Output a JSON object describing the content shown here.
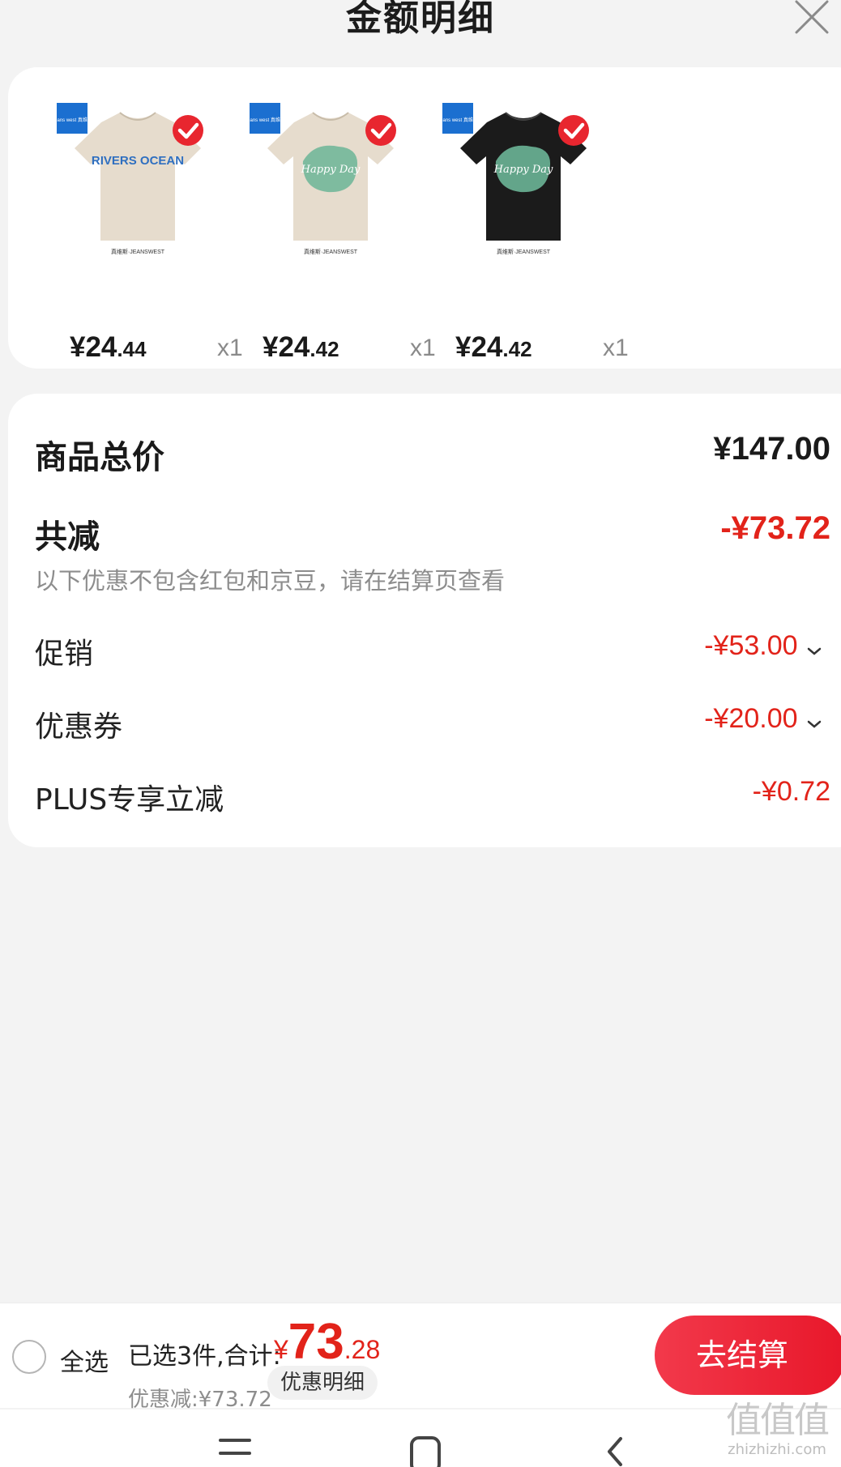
{
  "header": {
    "title": "金额明细",
    "close_icon": "close-icon"
  },
  "products": [
    {
      "price_int": "¥24",
      "price_dec": ".44",
      "qty": "x1",
      "shirt_color": "#e6dccd",
      "print": "RIVERS OCEAN",
      "brand_badge": "Jeans west 真维斯",
      "brand_text": "真维斯·JEANSWEST"
    },
    {
      "price_int": "¥24",
      "price_dec": ".42",
      "qty": "x1",
      "shirt_color": "#e6dccd",
      "print": "Happy Day",
      "brand_badge": "Jeans west 真维斯",
      "brand_text": "真维斯·JEANSWEST"
    },
    {
      "price_int": "¥24",
      "price_dec": ".42",
      "qty": "x1",
      "shirt_color": "#1b1b1b",
      "print": "Happy Day",
      "brand_badge": "Jeans west 真维斯",
      "brand_text": "真维斯·JEANSWEST"
    }
  ],
  "detail": {
    "total_label": "商品总价",
    "total_value": "¥147.00",
    "reduce_label": "共减",
    "reduce_value": "-¥73.72",
    "reduce_note": "以下优惠不包含红包和京豆，请在结算页查看",
    "promo_label": "促销",
    "promo_value": "-¥53.00",
    "coupon_label": "优惠券",
    "coupon_value": "-¥20.00",
    "plus_label": "PLUS专享立减",
    "plus_value": "-¥0.72"
  },
  "bottom": {
    "select_all": "全选",
    "selected_count": "已选3件,合计:",
    "total_symbol": "¥",
    "total_int": "73",
    "total_dec": ".28",
    "discount_text": "优惠减:¥73.72",
    "detail_link": "优惠明细",
    "checkout": "去结算"
  },
  "watermark": {
    "logo": "值值值",
    "sub": "zhizhizhi.com"
  },
  "colors": {
    "accent": "#e2231a",
    "check": "#e8262f",
    "badge": "#1b6fd0",
    "print_green": "#6bb597",
    "print_blue": "#2f6fc0"
  }
}
